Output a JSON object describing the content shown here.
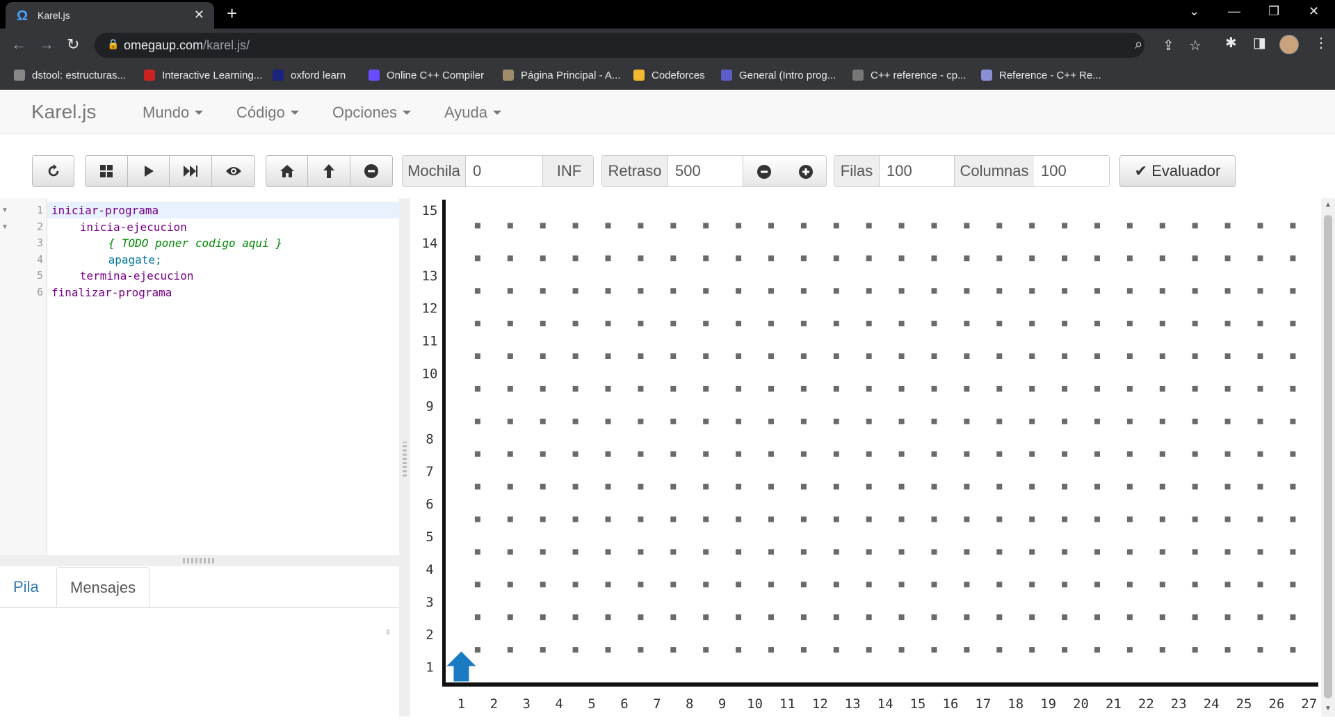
{
  "browser": {
    "tab_title": "Karel.js",
    "tab_icon": "Ω",
    "url_host": "omegaup.com",
    "url_path": "/karel.js/",
    "bookmarks": [
      {
        "label": "dstool: estructuras...",
        "color": "#888888"
      },
      {
        "label": "Interactive Learning...",
        "color": "#cc2222"
      },
      {
        "label": "oxford learn",
        "color": "#1a237e"
      },
      {
        "label": "Online C++ Compiler",
        "color": "#6a4cff"
      },
      {
        "label": "Página Principal - A...",
        "color": "#9e8c6a"
      },
      {
        "label": "Codeforces",
        "color": "#f2b830"
      },
      {
        "label": "General (Intro prog...",
        "color": "#5b5fc7"
      },
      {
        "label": "C++ reference - cp...",
        "color": "#777777"
      },
      {
        "label": "Reference - C++ Re...",
        "color": "#8a8fd6"
      }
    ]
  },
  "app": {
    "brand": "Karel.js",
    "menus": [
      "Mundo",
      "Código",
      "Opciones",
      "Ayuda"
    ]
  },
  "toolbar": {
    "icons": [
      "refresh-icon",
      "grid-icon",
      "play-icon",
      "fast-forward-icon",
      "eye-icon",
      "home-icon",
      "arrow-up-icon",
      "minus-circle-icon"
    ],
    "mochila_label": "Mochila",
    "mochila_value": "0",
    "inf_label": "INF",
    "retraso_label": "Retraso",
    "retraso_value": "500",
    "filas_label": "Filas",
    "filas_value": "100",
    "columnas_label": "Columnas",
    "columnas_value": "100",
    "evaluador_label": "Evaluador"
  },
  "editor": {
    "lines": [
      {
        "num": "1",
        "text": "iniciar-programa",
        "indent": 0,
        "style": "kw"
      },
      {
        "num": "2",
        "text": "inicia-ejecucion",
        "indent": 4,
        "style": "kw"
      },
      {
        "num": "3",
        "text": "{ TODO poner codigo aqui }",
        "indent": 8,
        "style": "cm"
      },
      {
        "num": "4",
        "text": "apagate;",
        "indent": 8,
        "style": "bi"
      },
      {
        "num": "5",
        "text": "termina-ejecucion",
        "indent": 4,
        "style": "kw"
      },
      {
        "num": "6",
        "text": "finalizar-programa",
        "indent": 0,
        "style": "kw"
      }
    ]
  },
  "panel_tabs": [
    "Pila",
    "Mensajes"
  ],
  "world": {
    "rows_visible": [
      "1",
      "2",
      "3",
      "4",
      "5",
      "6",
      "7",
      "8",
      "9",
      "10",
      "11",
      "12",
      "13",
      "14",
      "15"
    ],
    "cols_visible": [
      "1",
      "2",
      "3",
      "4",
      "5",
      "6",
      "7",
      "8",
      "9",
      "10",
      "11",
      "12",
      "13",
      "14",
      "15",
      "16",
      "17",
      "18",
      "19",
      "20",
      "21",
      "22",
      "23",
      "24",
      "25",
      "26",
      "27"
    ],
    "karel": {
      "row": 1,
      "col": 1,
      "direction": "north",
      "color": "#1a7bc3"
    }
  }
}
